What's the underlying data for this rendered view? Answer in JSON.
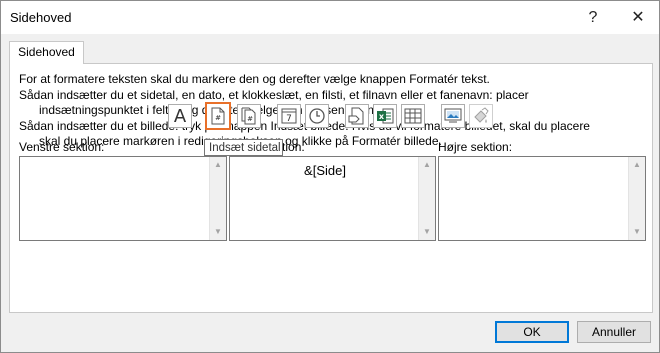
{
  "dialog": {
    "title": "Sidehoved",
    "help_glyph": "?",
    "close_glyph": "✕"
  },
  "tabs": [
    {
      "label": "Sidehoved"
    }
  ],
  "instructions": [
    "For at formatere teksten skal du markere den og derefter vælge knappen Formatér tekst.",
    "Sådan indsætter du et sidetal, en dato, et klokkeslæt, en filsti, et filnavn eller et fanenavn: placer",
    "indsætningspunktet i feltet, og derefter vælge den passende knap.",
    "Sådan indsætter du et billede: tryk på knappen Indsæt billede. Hvis du vil formatere billedet, skal du placere",
    "skal du placere markøren i redigeringsboksen og klikke på Formatér billede."
  ],
  "toolbar": {
    "buttons": [
      {
        "icon": "format-text-icon",
        "glyph": "A"
      },
      {
        "icon": "page-number-icon",
        "active": true
      },
      {
        "icon": "number-of-pages-icon"
      },
      {
        "icon": "date-icon",
        "glyph": "7"
      },
      {
        "icon": "time-icon"
      },
      {
        "icon": "file-path-icon"
      },
      {
        "icon": "file-name-icon"
      },
      {
        "icon": "sheet-name-icon"
      },
      {
        "icon": "picture-icon"
      },
      {
        "icon": "format-picture-icon",
        "disabled": true
      }
    ]
  },
  "tooltip": "Indsæt sidetal",
  "sections": {
    "left": {
      "label": "Venstre sektion:",
      "value": ""
    },
    "center": {
      "label": "Midtersektion:",
      "value": "&[Side]"
    },
    "right": {
      "label": "Højre sektion:",
      "value": ""
    }
  },
  "buttons": {
    "ok": "OK",
    "cancel": "Annuller"
  },
  "colors": {
    "active_border": "#e8702a",
    "default_button_border": "#0078d7",
    "excel_green": "#1e7145"
  }
}
